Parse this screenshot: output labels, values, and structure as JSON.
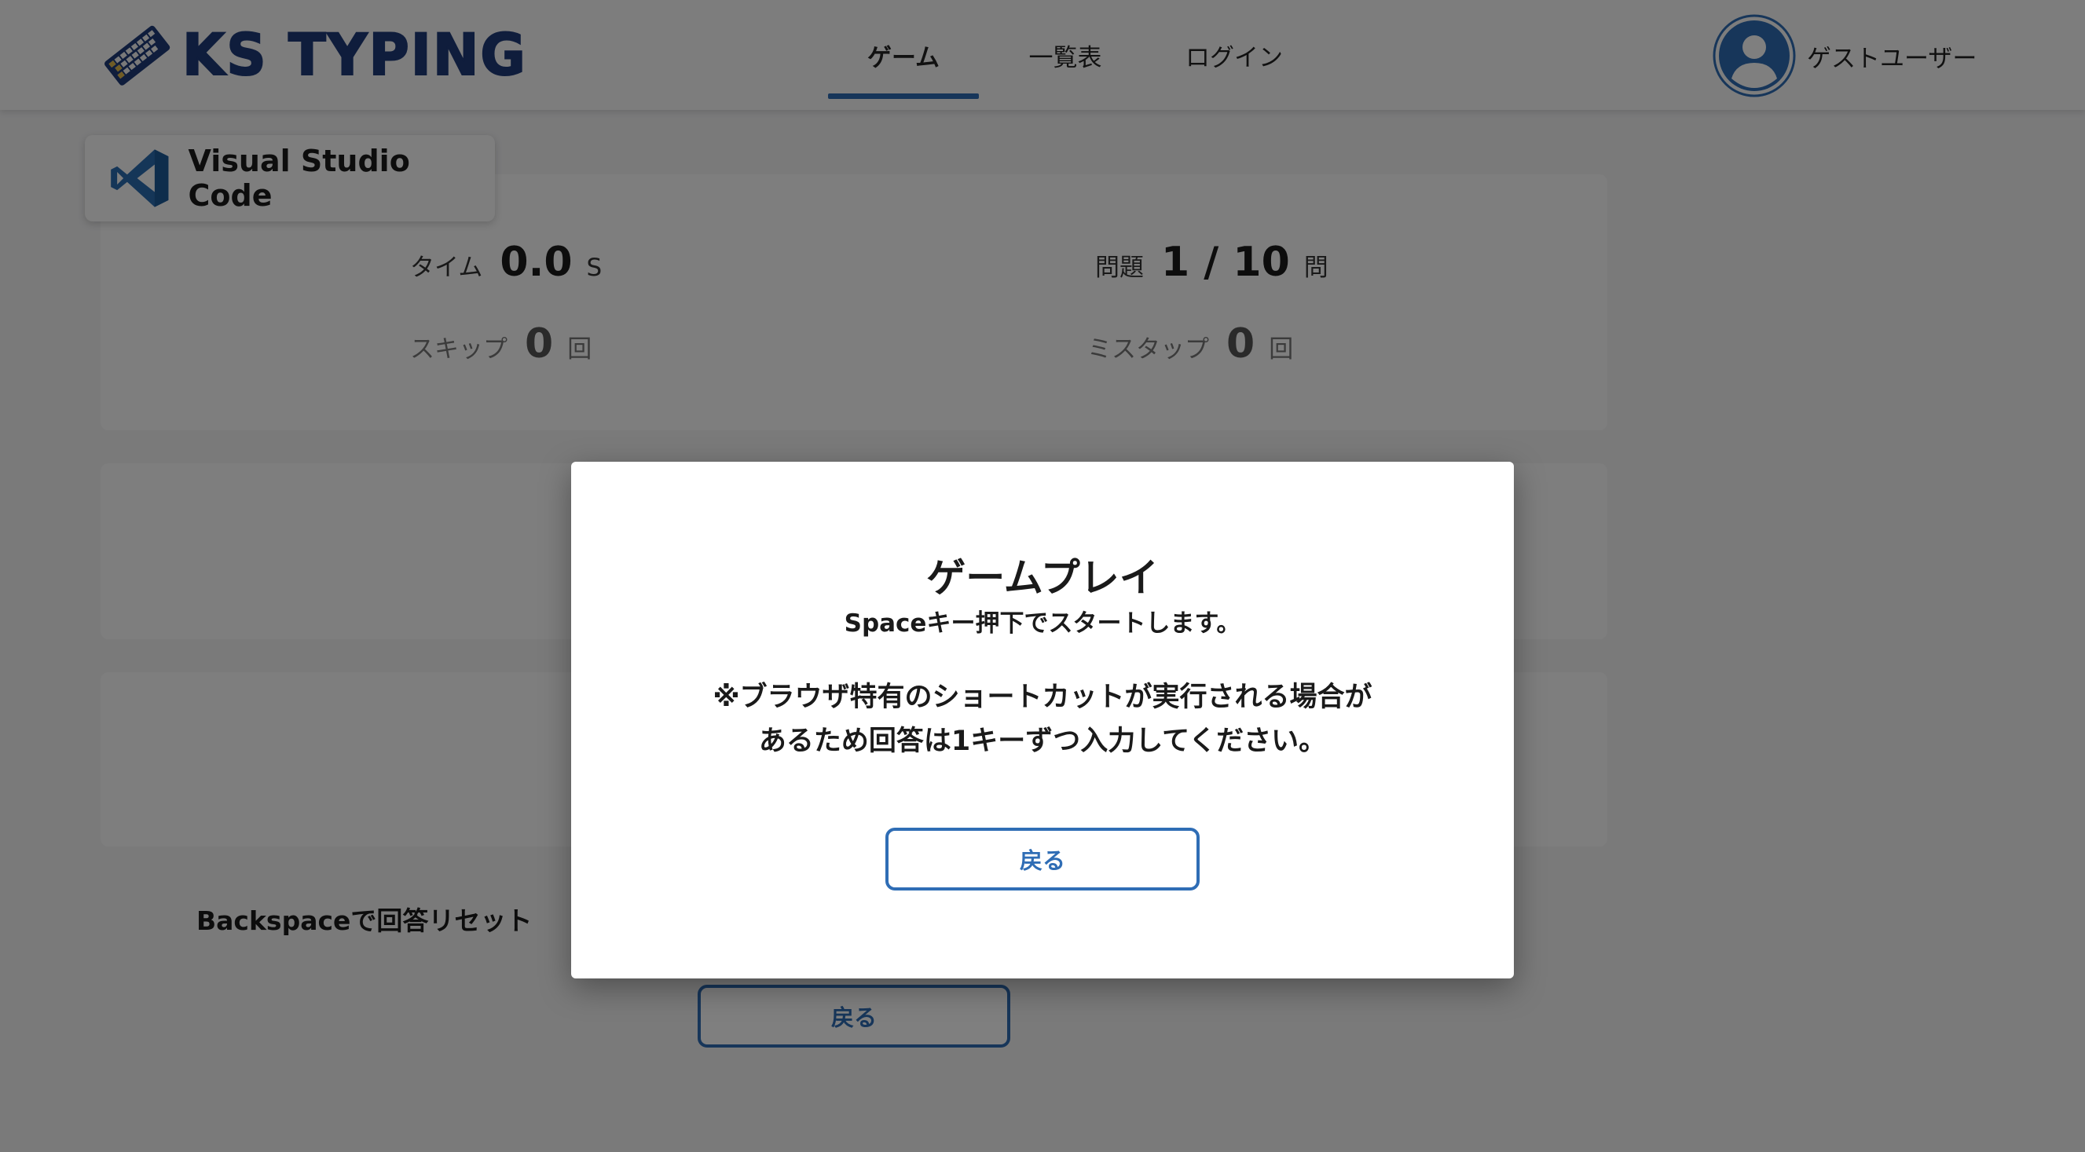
{
  "header": {
    "logo_text": "KS TYPING",
    "nav": [
      {
        "label": "ゲーム",
        "active": true
      },
      {
        "label": "一覧表",
        "active": false
      },
      {
        "label": "ログイン",
        "active": false
      }
    ],
    "user_name": "ゲストユーザー",
    "accent_color": "#2f6db5",
    "logo_color": "#1e3a78"
  },
  "app": {
    "name": "Visual Studio Code",
    "icon": "vscode-icon"
  },
  "stats": {
    "time": {
      "label": "タイム",
      "value": "0.0",
      "unit": "S"
    },
    "question": {
      "label": "問題",
      "value": "1 / 10",
      "unit": "問"
    },
    "skip": {
      "label": "スキップ",
      "value": "0",
      "unit": "回"
    },
    "miss": {
      "label": "ミスタップ",
      "value": "0",
      "unit": "回"
    }
  },
  "hint": "Backspaceで回答リセット",
  "back_button": "戻る",
  "modal": {
    "title": "ゲームプレイ",
    "subtitle": "Spaceキー押下でスタートします。",
    "note_line1": "※ブラウザ特有のショートカットが実行される場合が",
    "note_line2": "あるため回答は1キーずつ入力してください。",
    "back_button": "戻る"
  }
}
